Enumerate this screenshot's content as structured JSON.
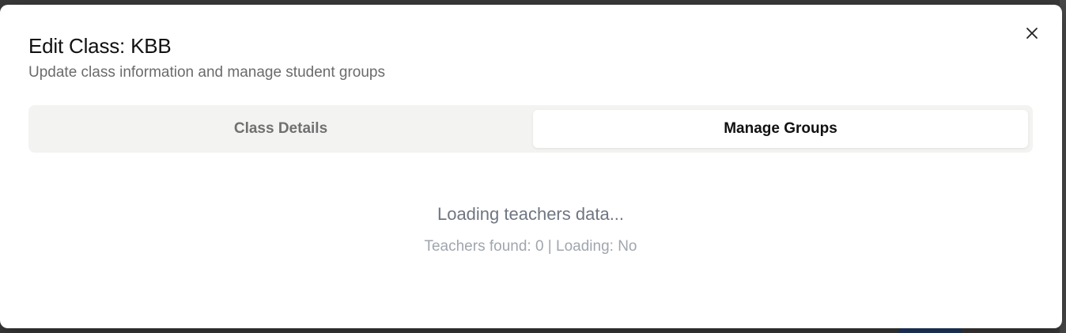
{
  "dialog": {
    "title": "Edit Class: KBB",
    "subtitle": "Update class information and manage student groups",
    "close_icon": "close-icon"
  },
  "tabs": [
    {
      "label": "Class Details",
      "active": false
    },
    {
      "label": "Manage Groups",
      "active": true
    }
  ],
  "loading": {
    "title": "Loading teachers data...",
    "status": "Teachers found: 0 | Loading: No"
  },
  "colors": {
    "title": "#111111",
    "subtitle": "#6b6b6b",
    "tab_bar_bg": "#f3f3f1",
    "tab_active_bg": "#ffffff",
    "loading_title": "#6f7681",
    "loading_status": "#a0a6ae"
  }
}
